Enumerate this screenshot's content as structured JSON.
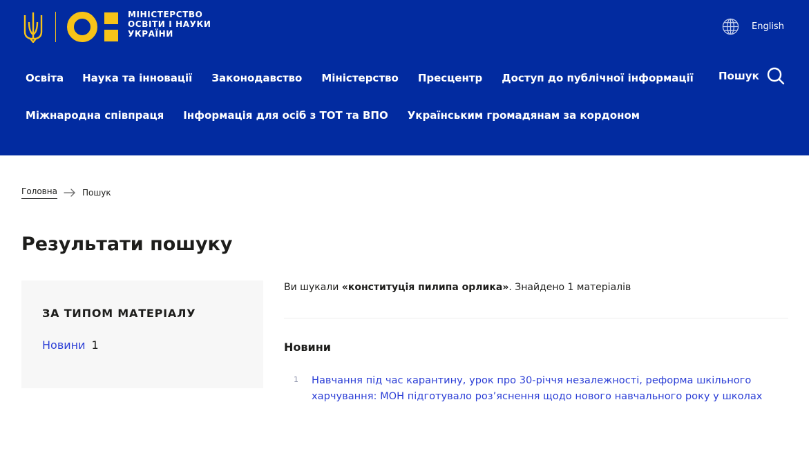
{
  "header": {
    "logo_text": [
      "МІНІСТЕРСТВО",
      "ОСВІТИ І НАУКИ",
      "УКРАЇНИ"
    ],
    "language_label": "English",
    "search_label": "Пошук",
    "nav_row1": [
      "Освіта",
      "Наука та інновації",
      "Законодавство",
      "Міністерство",
      "Пресцентр",
      "Доступ до публічної інформації"
    ],
    "nav_row2": [
      "Міжнародна співпраця",
      "Інформація для осіб з ТОТ та ВПО",
      "Українським громадянам за кордоном"
    ]
  },
  "breadcrumb": {
    "home": "Головна",
    "current": "Пошук"
  },
  "page_title": "Результати пошуку",
  "filter": {
    "heading": "ЗА ТИПОМ МАТЕРІАЛУ",
    "items": [
      {
        "label": "Новини",
        "count": "1"
      }
    ]
  },
  "results": {
    "summary_prefix": "Ви шукали ",
    "query": "«конституція пилипа орлика»",
    "summary_suffix": ". Знайдено 1 матеріалів",
    "section_title": "Новини",
    "items": [
      {
        "number": "1",
        "title": "Навчання під час карантину, урок про 30-річчя незалежності, реформа шкільного харчування: МОН підготувало роз’яснення щодо нового навчального року у школах"
      }
    ]
  },
  "colors": {
    "header_bg": "#022ba0",
    "logo_yellow": "#f7c318",
    "link_blue": "#2c3fd6",
    "filter_bg": "#f7f7f7"
  },
  "icons": {
    "coat_of_arms": "trident-icon",
    "language": "globe-icon",
    "search": "search-icon",
    "breadcrumb_separator": "arrow-right-icon"
  }
}
